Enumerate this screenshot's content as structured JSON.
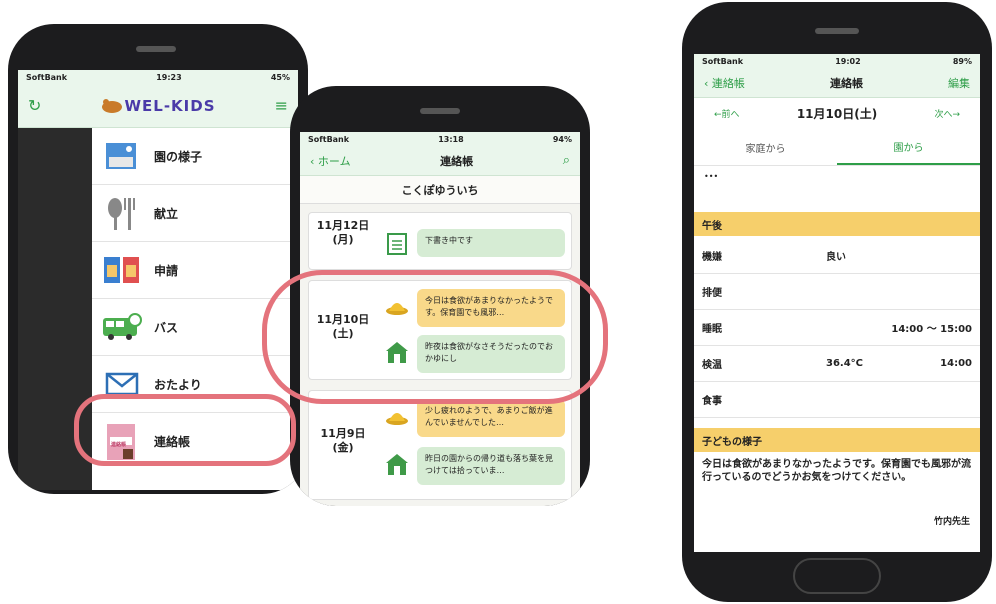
{
  "phone1": {
    "status": {
      "carrier": "SoftBank",
      "time": "19:23",
      "battery": "45%"
    },
    "logo": "WEL-KIDS",
    "menu": [
      {
        "label": "園の様子",
        "icon": "photo-icon"
      },
      {
        "label": "献立",
        "icon": "fork-knife-icon"
      },
      {
        "label": "申請",
        "icon": "form-icon"
      },
      {
        "label": "バス",
        "icon": "bus-icon"
      },
      {
        "label": "おたより",
        "icon": "mail-icon"
      },
      {
        "label": "連絡帳",
        "icon": "notebook-icon"
      }
    ],
    "notebook_icon_text": "連絡帳"
  },
  "phone2": {
    "status": {
      "carrier": "SoftBank",
      "time": "13:18",
      "battery": "94%"
    },
    "nav": {
      "back": "ホーム",
      "title": "連絡帳"
    },
    "kid_name": "こくぽゆういち",
    "days": [
      {
        "date": "11月12日",
        "weekday": "(月)",
        "messages": [
          {
            "text": "下書き中です"
          }
        ]
      },
      {
        "date": "11月10日",
        "weekday": "(土)",
        "messages": [
          {
            "text": "今日は食欲があまりなかったようです。保育園でも風邪…"
          },
          {
            "text": "昨夜は食欲がなさそうだったのでおかゆにし"
          }
        ]
      },
      {
        "date": "11月9日",
        "weekday": "(金)",
        "messages": [
          {
            "text": "少し疲れのようで、あまりご飯が進んでいませんでした…"
          },
          {
            "text": "昨日の園からの帰り道も落ち葉を見つけては拾っていま…"
          }
        ]
      }
    ]
  },
  "phone3": {
    "status": {
      "carrier": "SoftBank",
      "time": "19:02",
      "battery": "89%"
    },
    "nav": {
      "back": "連絡帳",
      "title": "連絡帳",
      "edit": "編集"
    },
    "date_nav": {
      "prev": "←前へ",
      "date": "11月10日(土)",
      "next": "次へ→"
    },
    "tabs": [
      {
        "label": "家庭から"
      },
      {
        "label": "園から"
      }
    ],
    "ellipsis": "•••",
    "section_afternoon": "午後",
    "rows": [
      {
        "label": "機嫌",
        "value": "良い",
        "time": ""
      },
      {
        "label": "排便",
        "value": "",
        "time": ""
      },
      {
        "label": "睡眠",
        "value": "",
        "time": "14:00 ～ 15:00"
      },
      {
        "label": "検温",
        "value": "36.4°C",
        "time": "14:00"
      },
      {
        "label": "食事",
        "value": "",
        "time": ""
      }
    ],
    "section_child": "子どもの様子",
    "note": "今日は食欲があまりなかったようです。保育園でも風邪が流行っているのでどうかお気をつけてください。",
    "signature": "竹内先生"
  }
}
